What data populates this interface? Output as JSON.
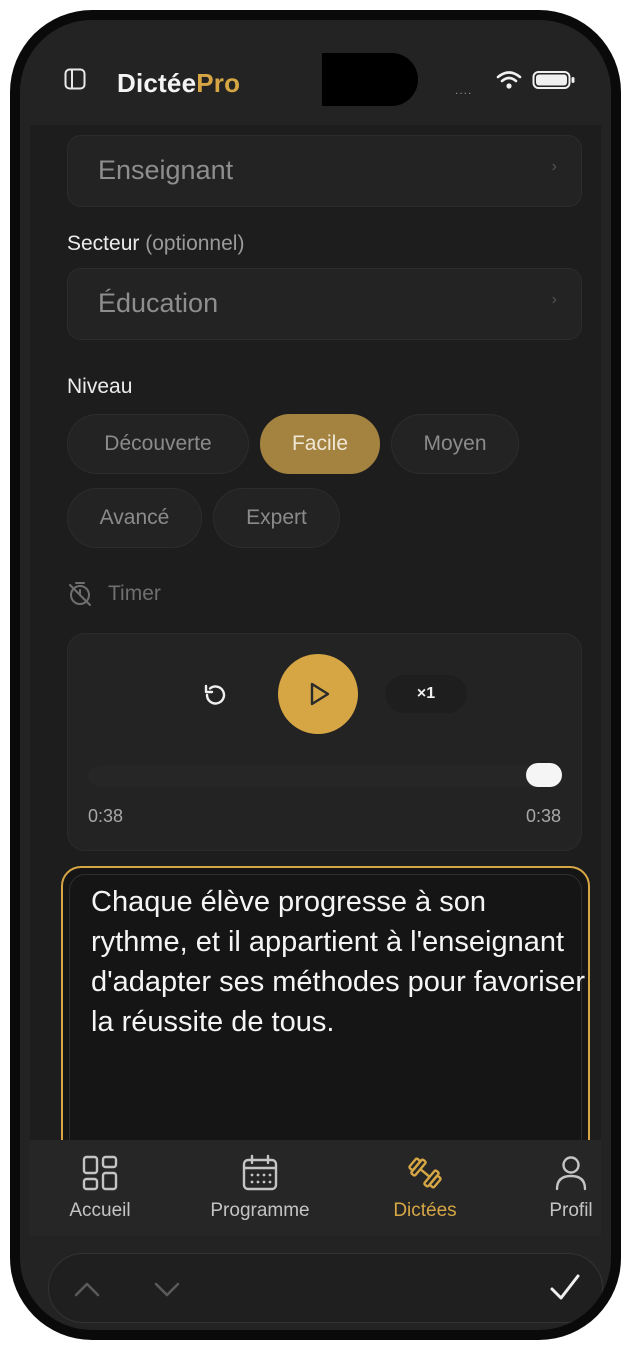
{
  "app": {
    "brand_part1": "Dictée",
    "brand_part2": "Pro"
  },
  "status": {
    "signal": "....",
    "icons": [
      "wifi-icon",
      "battery-icon"
    ]
  },
  "form": {
    "role_value": "Enseignant",
    "sector_label": "Secteur",
    "sector_optional": "(optionnel)",
    "sector_value": "Éducation",
    "level_label": "Niveau",
    "levels": [
      "Découverte",
      "Facile",
      "Moyen",
      "Avancé",
      "Expert"
    ],
    "selected_level": "Facile",
    "timer_label": "Timer"
  },
  "player": {
    "speed_label": "×1",
    "current_time": "0:38",
    "total_time": "0:38",
    "progress": 1.0
  },
  "dictation": {
    "text": "Chaque élève progresse à son rythme, et il appartient à l'enseignant d'adapter ses méthodes pour favoriser la réussite de tous."
  },
  "tabs": [
    {
      "label": "Accueil",
      "icon": "grid-icon"
    },
    {
      "label": "Programme",
      "icon": "calendar-icon"
    },
    {
      "label": "Dictées",
      "icon": "dumbbell-icon"
    },
    {
      "label": "Profil",
      "icon": "user-icon"
    }
  ],
  "active_tab": "Dictées",
  "colors": {
    "accent": "#d6a645",
    "background": "#1d1d1d",
    "surface": "#232323"
  }
}
